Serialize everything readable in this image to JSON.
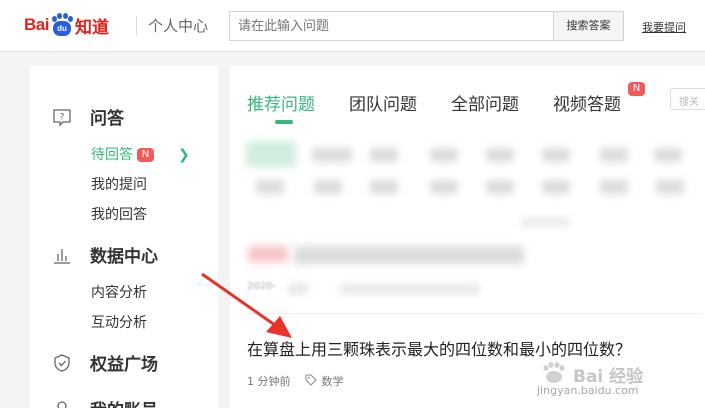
{
  "header": {
    "logo_bai": "Bai",
    "logo_du": "du",
    "logo_zhidao": "知道",
    "center_title": "个人中心",
    "search_placeholder": "请在此输入问题",
    "search_button": "搜索答案",
    "ask_link": "我要提问"
  },
  "sidebar": {
    "sections": [
      {
        "icon": "question-icon",
        "label": "问答"
      },
      {
        "icon": "bar-chart-icon",
        "label": "数据中心"
      },
      {
        "icon": "shield-check-icon",
        "label": "权益广场"
      },
      {
        "icon": "account-icon",
        "label": "我的账号"
      }
    ],
    "qa_items": [
      {
        "label": "待回答",
        "badge": "N",
        "active": true
      },
      {
        "label": "我的提问"
      },
      {
        "label": "我的回答"
      }
    ],
    "data_items": [
      {
        "label": "内容分析"
      },
      {
        "label": "互动分析"
      }
    ]
  },
  "main": {
    "tabs": [
      {
        "label": "推荐问题",
        "active": true
      },
      {
        "label": "团队问题"
      },
      {
        "label": "全部问题"
      },
      {
        "label": "视频答题",
        "badge": "N"
      }
    ],
    "search_mini_placeholder": "搜关",
    "blurred_date": "2020-",
    "question": {
      "title": "在算盘上用三颗珠表示最大的四位数和最小的四位数？",
      "time": "1 分钟前",
      "tag": "数学"
    }
  },
  "watermark": {
    "line1": "Bai 经验",
    "line2": "jingyan.baidu.com"
  },
  "colors": {
    "accent_green": "#38b77c",
    "badge_red": "#ef5b5b",
    "brand_red": "#e1251b",
    "brand_blue": "#2a5ed8",
    "arrow_red": "#e8322c"
  }
}
